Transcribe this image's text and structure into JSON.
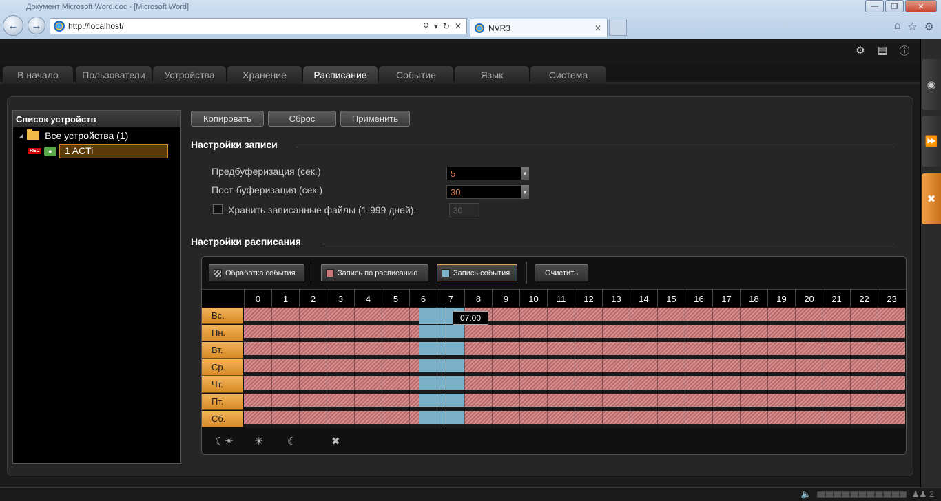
{
  "browser": {
    "window_title": "Документ Microsoft Word.doc - [Microsoft Word]",
    "address": "http://localhost/",
    "tab_label": "NVR3"
  },
  "menu": {
    "tabs": [
      "В начало",
      "Пользователи",
      "Устройства",
      "Хранение",
      "Расписание",
      "Событие",
      "Язык",
      "Система"
    ],
    "active": "Расписание"
  },
  "device_list": {
    "title": "Список устройств",
    "root": "Все устройства (1)",
    "rec_badge": "REC",
    "device": "1 ACTi"
  },
  "toolbar": {
    "copy": "Копировать",
    "reset": "Сброс",
    "apply": "Применить"
  },
  "record_settings": {
    "title": "Настройки записи",
    "prebuffer_label": "Предбуферизация (сек.)",
    "prebuffer_value": "5",
    "postbuffer_label": "Пост-буферизация (сек.)",
    "postbuffer_value": "30",
    "keep_label": "Хранить записанные файлы (1-999 дней).",
    "keep_checked": false,
    "keep_value": "30"
  },
  "schedule": {
    "title": "Настройки расписания",
    "modes": {
      "event_processing": "Обработка события",
      "scheduled_recording": "Запись по расписанию",
      "event_recording": "Запись события",
      "clear": "Очистить"
    },
    "colors": {
      "scheduled": "#c97a7a",
      "event": "#7ab0c8",
      "day_label": "#e8a040"
    },
    "hours": [
      "0",
      "1",
      "2",
      "3",
      "4",
      "5",
      "6",
      "7",
      "8",
      "9",
      "10",
      "11",
      "12",
      "13",
      "14",
      "15",
      "16",
      "17",
      "18",
      "19",
      "20",
      "21",
      "22",
      "23"
    ],
    "days": [
      "Вс.",
      "Пн.",
      "Вт.",
      "Ср.",
      "Чт.",
      "Пт.",
      "Сб."
    ],
    "event_block_hours": [
      6.35,
      8.0
    ],
    "cursor_time": "07:00",
    "tools": [
      "day-night-icon",
      "sun-icon",
      "moon-icon",
      "close-icon"
    ]
  },
  "status": {
    "user_count": "2"
  }
}
